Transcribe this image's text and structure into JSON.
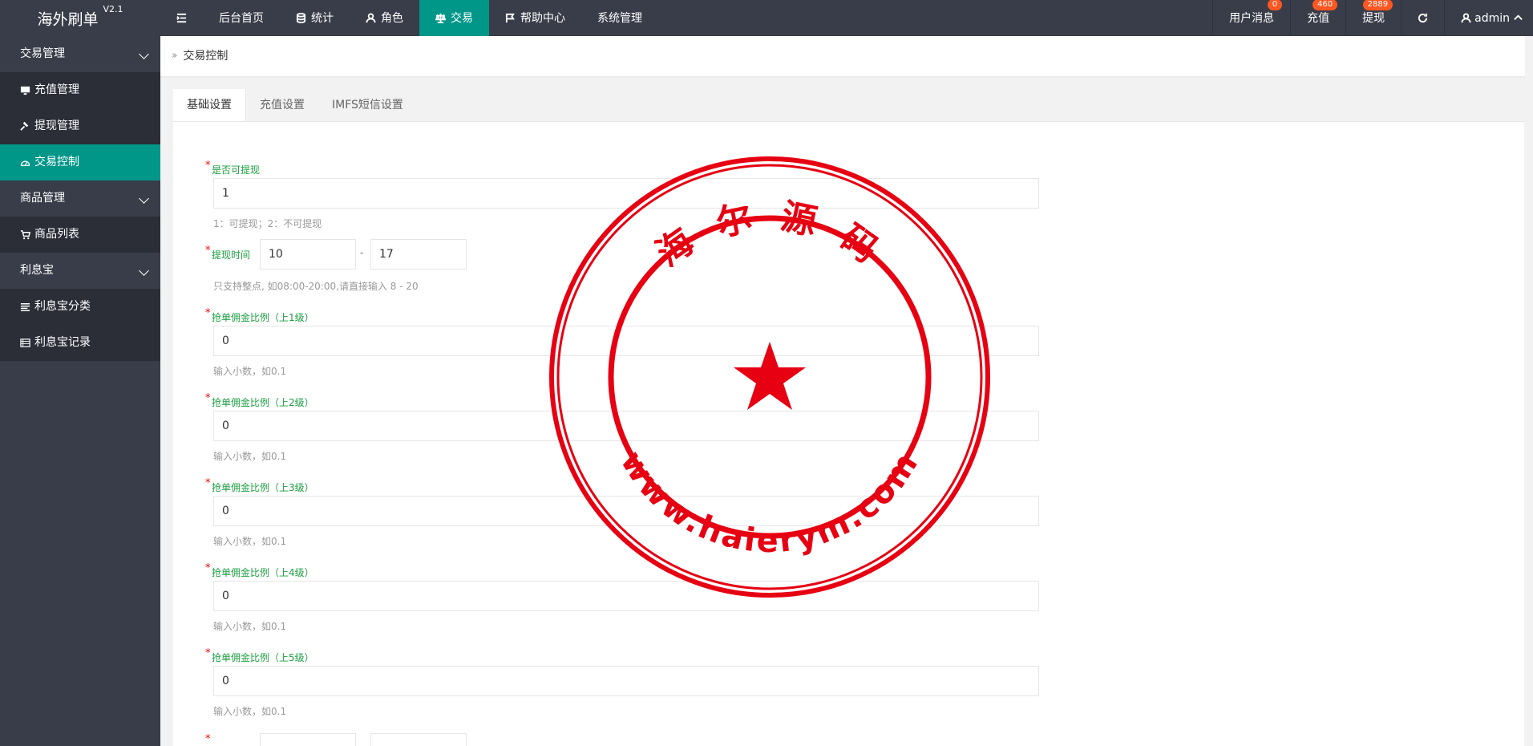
{
  "app": {
    "title": "海外刷单",
    "version": "V2.1"
  },
  "header": {
    "menu_toggle_icon": "menu-fold-icon",
    "nav": [
      {
        "label": "后台首页",
        "icon": ""
      },
      {
        "label": "统计",
        "icon": "database-icon"
      },
      {
        "label": "角色",
        "icon": "user-icon"
      },
      {
        "label": "交易",
        "icon": "scale-icon",
        "active": true
      },
      {
        "label": "帮助中心",
        "icon": "flag-icon"
      },
      {
        "label": "系统管理",
        "icon": ""
      }
    ],
    "right": {
      "messages_label": "用户消息",
      "messages_badge": "0",
      "recharge_label": "充值",
      "recharge_badge": "460",
      "withdraw_label": "提现",
      "withdraw_badge": "2889",
      "refresh_icon": "refresh-icon",
      "user_label": "admin"
    }
  },
  "sidebar": {
    "groups": [
      {
        "label": "交易管理",
        "items": [
          {
            "label": "充值管理",
            "icon": "monitor-icon"
          },
          {
            "label": "提现管理",
            "icon": "gavel-icon"
          },
          {
            "label": "交易控制",
            "icon": "dashboard-icon",
            "active": true
          }
        ]
      },
      {
        "label": "商品管理",
        "items": [
          {
            "label": "商品列表",
            "icon": "cart-icon"
          }
        ]
      },
      {
        "label": "利息宝",
        "items": [
          {
            "label": "利息宝分类",
            "icon": "list-icon"
          },
          {
            "label": "利息宝记录",
            "icon": "table-icon"
          }
        ]
      }
    ]
  },
  "breadcrumb": {
    "label": "交易控制"
  },
  "tabs": [
    "基础设置",
    "充值设置",
    "IMFS短信设置"
  ],
  "form": {
    "can_withdraw": {
      "label": "是否可提现",
      "value": "1",
      "hint": "1：可提现；2：不可提现"
    },
    "withdraw_time": {
      "label": "提现时间",
      "start": "10",
      "end": "17",
      "separator": "-",
      "hint": "只支持整点, 如08:00-20:00,请直接输入 8 - 20"
    },
    "commission": [
      {
        "label": "抢单佣金比例（上1级）",
        "value": "0",
        "hint": "输入小数，如0.1"
      },
      {
        "label": "抢单佣金比例（上2级）",
        "value": "0",
        "hint": "输入小数，如0.1"
      },
      {
        "label": "抢单佣金比例（上3级）",
        "value": "0",
        "hint": "输入小数，如0.1"
      },
      {
        "label": "抢单佣金比例（上4级）",
        "value": "0",
        "hint": "输入小数，如0.1"
      },
      {
        "label": "抢单佣金比例（上5级）",
        "value": "0",
        "hint": "输入小数，如0.1"
      }
    ],
    "required_mark": "*"
  },
  "watermark": {
    "top_text": "海 尔 源 码",
    "bottom_text": "www.haierym.com",
    "color": "#e60012"
  },
  "colors": {
    "header_bg": "#393d49",
    "accent": "#009688",
    "badge": "#ff5722",
    "label_green": "#1b9f41"
  }
}
